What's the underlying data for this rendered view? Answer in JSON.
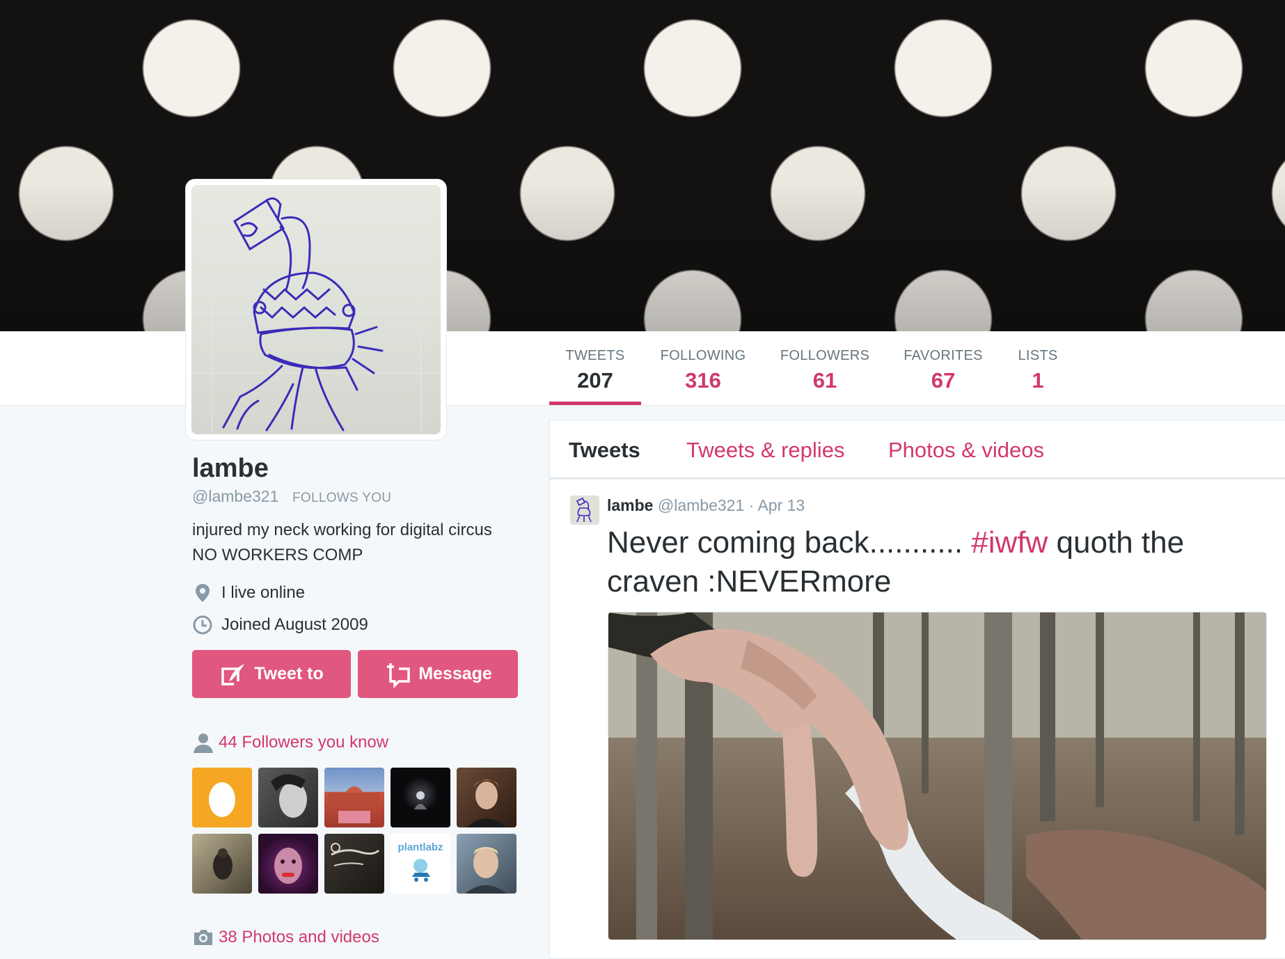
{
  "profile": {
    "name": "lambe",
    "screen_name": "@lambe321",
    "follows_you": "FOLLOWS YOU",
    "bio_line1": "injured my neck working for digital circus",
    "bio_line2": "NO WORKERS COMP",
    "location": "I live online",
    "joined": "Joined August 2009"
  },
  "stats": [
    {
      "label": "TWEETS",
      "value": "207",
      "active": true
    },
    {
      "label": "FOLLOWING",
      "value": "316"
    },
    {
      "label": "FOLLOWERS",
      "value": "61"
    },
    {
      "label": "FAVORITES",
      "value": "67"
    },
    {
      "label": "LISTS",
      "value": "1"
    }
  ],
  "actions": {
    "tweet_to": "Tweet to",
    "message": "Message"
  },
  "followers_you_know": {
    "label": "44 Followers you know",
    "tile_icons": [
      "egg-avatar",
      "portrait-avatar",
      "palace-avatar",
      "dark-avatar",
      "person-avatar",
      "animal-avatar",
      "face-avatar",
      "sign-avatar",
      "plantlabz-avatar",
      "man-avatar"
    ],
    "plantlabz_text": "plantlabz"
  },
  "photos_and_videos": "38 Photos and videos",
  "tabs": [
    {
      "label": "Tweets",
      "active": true
    },
    {
      "label": "Tweets & replies"
    },
    {
      "label": "Photos & videos"
    }
  ],
  "tweet": {
    "name": "lambe",
    "handle": "@lambe321",
    "separator": "·",
    "date": "Apr 13",
    "text_before": "Never coming back........... ",
    "hashtag": "#iwfw",
    "text_after": " quoth the craven :NEVERmore"
  },
  "colors": {
    "accent": "#d2386c",
    "button": "#e0577f",
    "text": "#292f33",
    "muted": "#8899a6",
    "background": "#f5f8fa"
  }
}
